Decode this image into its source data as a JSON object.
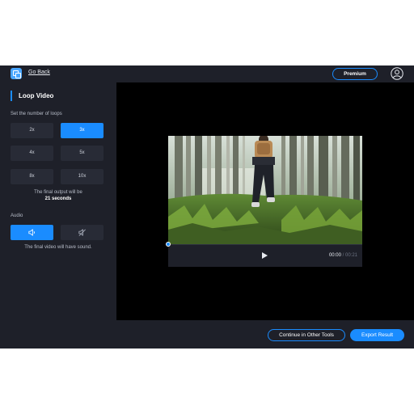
{
  "topbar": {
    "go_back": "Go Back",
    "premium": "Premium"
  },
  "sidebar": {
    "title": "Loop Video",
    "loops_label": "Set the number of loops",
    "loop_options": [
      "2x",
      "3x",
      "4x",
      "5x",
      "8x",
      "10x"
    ],
    "selected_loop": "3x",
    "final_output_text": "The final output will be",
    "final_output_value": "21 seconds",
    "audio_label": "Audio",
    "audio_selected": "sound-on",
    "audio_note": "The final video will have sound."
  },
  "player": {
    "current_time": "00:00",
    "separator": " / ",
    "total_time": "00:21",
    "progress": 0
  },
  "bottom": {
    "continue_label": "Continue in Other Tools",
    "export_label": "Export Result"
  },
  "colors": {
    "accent": "#1a8cff",
    "panel": "#1e2029",
    "button": "#282b36"
  }
}
